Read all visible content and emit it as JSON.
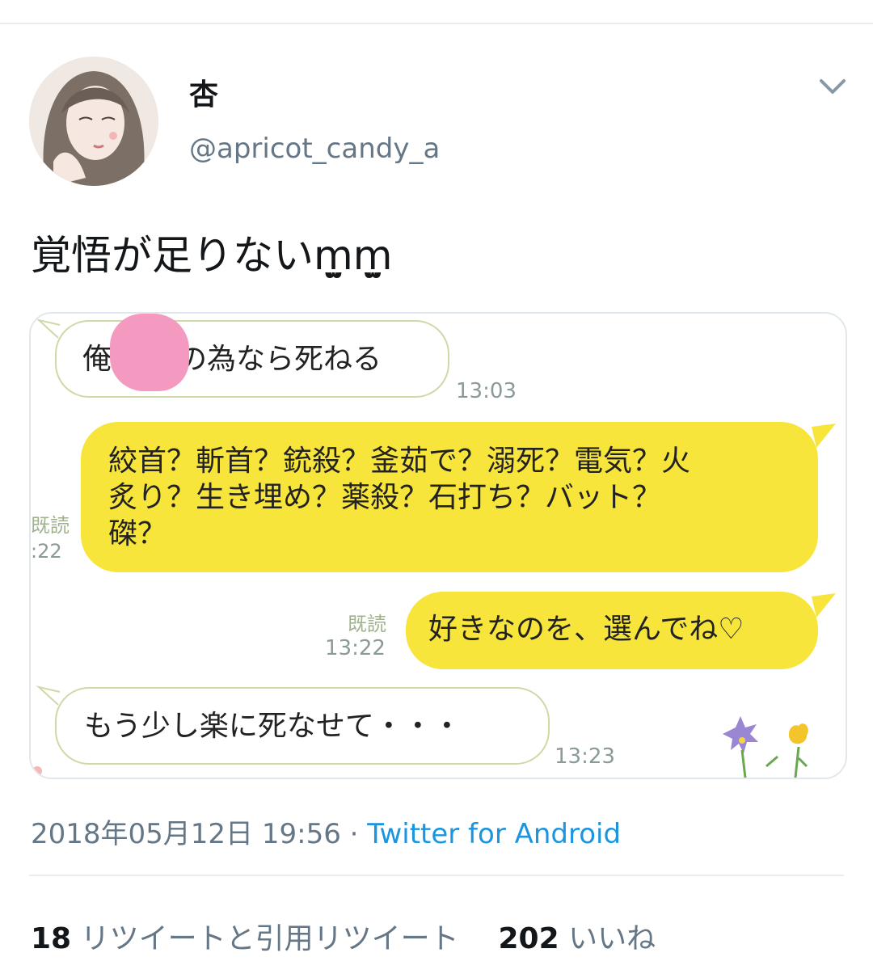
{
  "tweet": {
    "display_name": "杏",
    "handle": "@apricot_candy_a",
    "text": "覚悟が足りないm̤̫m̤̫",
    "timestamp": "2018年05月12日 19:56",
    "separator": "·",
    "source": "Twitter for Android",
    "retweet_count": "18",
    "retweet_label": "リツイートと引用リツイート",
    "like_count": "202",
    "like_label": "いいね"
  },
  "chat": {
    "messages": [
      {
        "side": "in",
        "text_a": "俺",
        "text_b": "の為なら死ねる",
        "time": "13:03"
      },
      {
        "side": "out",
        "line1": "絞首？斬首？銃殺？釜茹で？溺死？電気？火",
        "line2": "炙り？生き埋め？薬殺？石打ち？バット？",
        "line3": "磔？",
        "read": "既読",
        "time": ":22"
      },
      {
        "side": "out",
        "text": "好きなのを、選んでね♡",
        "read": "既読",
        "time": "13:22"
      },
      {
        "side": "in",
        "text": "もう少し楽に死なせて・・・",
        "time": "13:23"
      }
    ]
  },
  "colors": {
    "link": "#1b95e0",
    "secondary": "#657786",
    "bubble_out": "#f7e53b",
    "privacy_blur": "#f49ac1"
  },
  "icons": [
    "avatar",
    "chevron-down-icon",
    "flower-decoration"
  ]
}
